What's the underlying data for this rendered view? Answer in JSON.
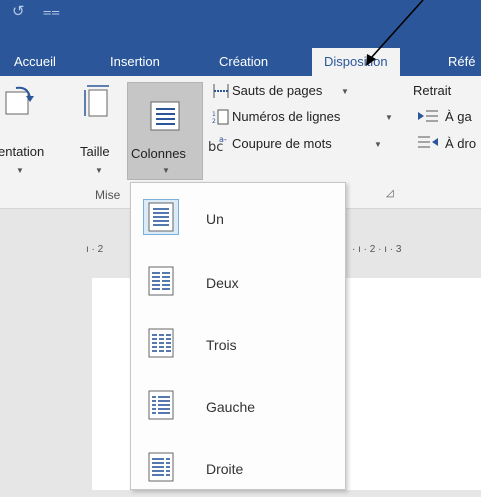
{
  "qat": {
    "undo": "↺",
    "customize": "⩵"
  },
  "tabs": [
    {
      "label": "Accueil"
    },
    {
      "label": "Insertion"
    },
    {
      "label": "Création"
    },
    {
      "label": "Disposition"
    },
    {
      "label": "Réfé"
    }
  ],
  "ribbon": {
    "orientation_label": "entation",
    "size_label": "Taille",
    "columns_label": "Colonnes",
    "breaks_label": "Sauts de pages",
    "line_numbers_label": "Numéros de lignes",
    "hyphenation_label": "Coupure de mots",
    "indent_title": "Retrait",
    "indent_left_label": "À ga",
    "indent_right_label": "À dro",
    "group_label": "Mise"
  },
  "ruler": {
    "left_mark": "2",
    "right_marks": "2 · ı · 3"
  },
  "columns_menu": {
    "items": [
      {
        "label": "Un",
        "columns": 1
      },
      {
        "label": "Deux",
        "columns": 2
      },
      {
        "label": "Trois",
        "columns": 3
      },
      {
        "label": "Gauche",
        "columns": 2
      },
      {
        "label": "Droite",
        "columns": 2
      }
    ],
    "selected": "Un"
  },
  "colors": {
    "ribbon_blue": "#2b579a",
    "ribbon_bg": "#f3f3f3",
    "selected_border": "#7aaedb"
  }
}
